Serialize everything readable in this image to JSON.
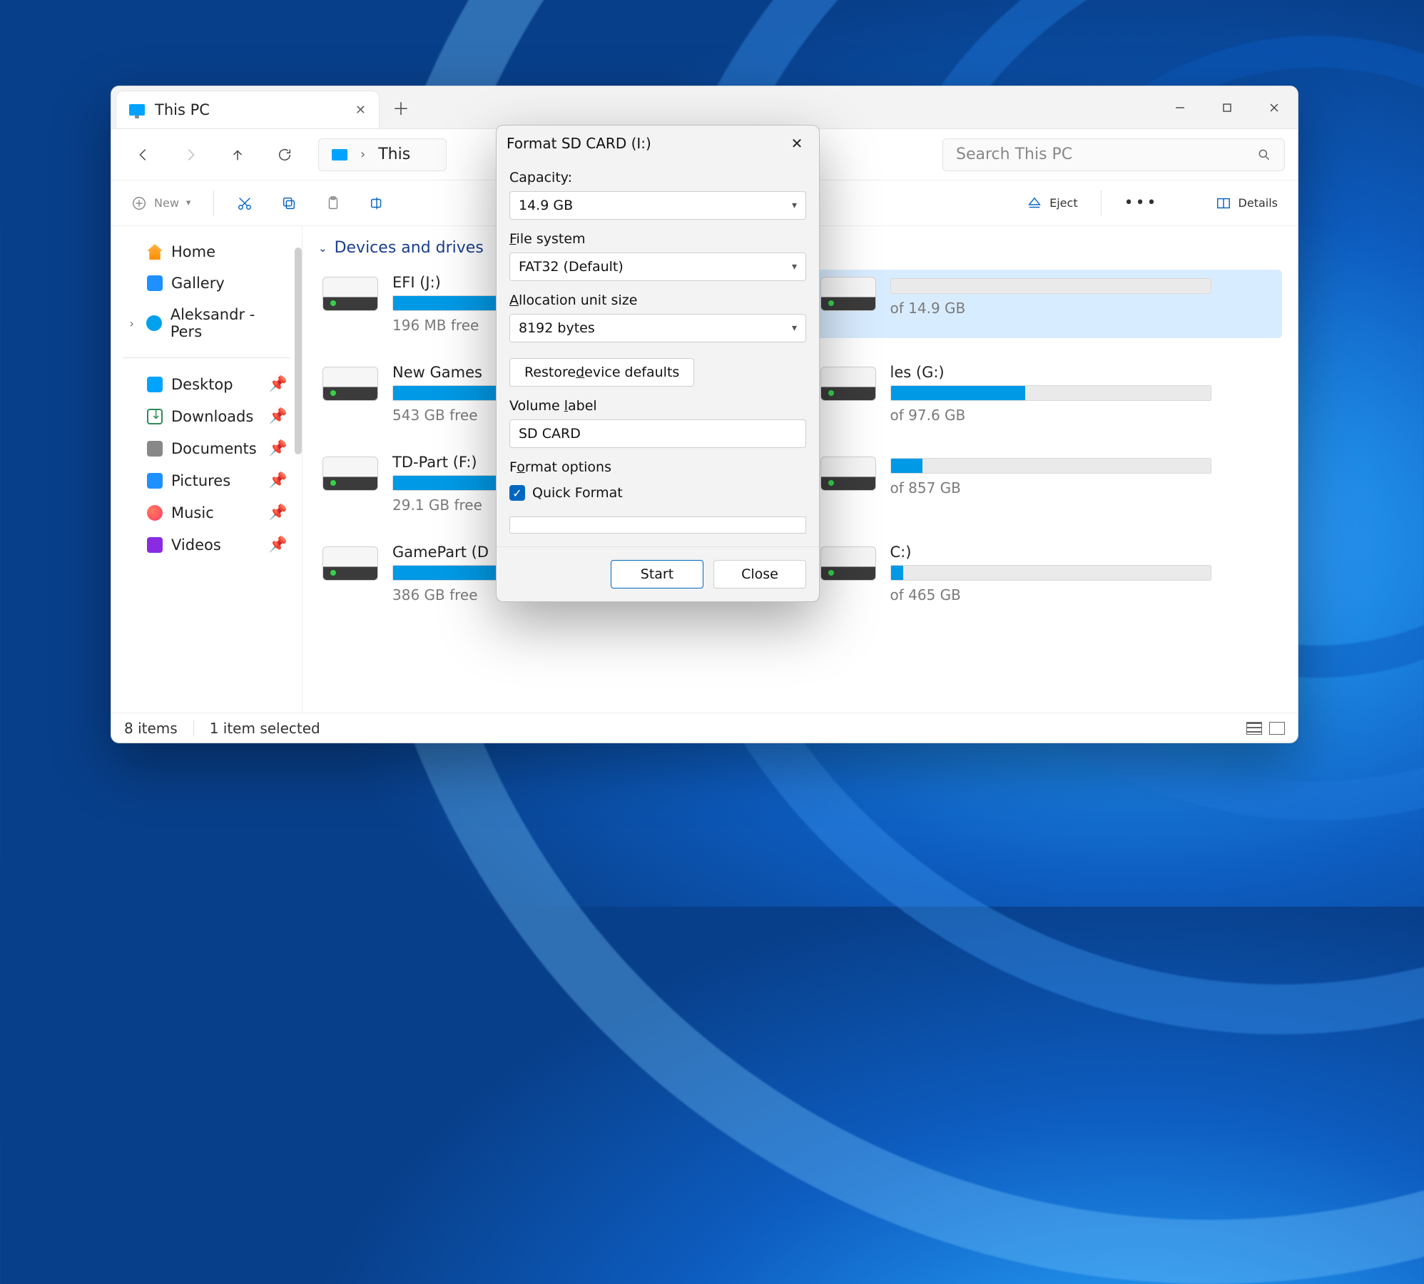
{
  "explorer": {
    "tab_title": "This PC",
    "address": "This",
    "search_placeholder": "Search This PC",
    "toolbar": {
      "new": "New",
      "eject": "Eject",
      "details": "Details"
    },
    "sidebar": {
      "home": "Home",
      "gallery": "Gallery",
      "onedrive": "Aleksandr - Pers",
      "desktop": "Desktop",
      "downloads": "Downloads",
      "documents": "Documents",
      "pictures": "Pictures",
      "music": "Music",
      "videos": "Videos"
    },
    "section_header": "Devices and drives",
    "drives": [
      {
        "name": "EFI (J:)",
        "free": "196 MB free",
        "fill": 35,
        "selected": false
      },
      {
        "name": "",
        "free": "of 14.9 GB",
        "fill": 0,
        "selected": true
      },
      {
        "name": "New Games",
        "free": "543 GB free",
        "fill": 68,
        "selected": false
      },
      {
        "name": "les (G:)",
        "free": "of 97.6 GB",
        "fill": 42,
        "selected": false
      },
      {
        "name": "TD-Part (F:)",
        "free": "29.1 GB free",
        "fill": 92,
        "selected": false
      },
      {
        "name": "",
        "free": "of 857 GB",
        "fill": 10,
        "selected": false
      },
      {
        "name": "GamePart (D",
        "free": "386 GB free",
        "fill": 60,
        "selected": false
      },
      {
        "name": "C:)",
        "free": "of 465 GB",
        "fill": 4,
        "selected": false
      }
    ],
    "status": {
      "items": "8 items",
      "selected": "1 item selected"
    }
  },
  "dialog": {
    "title": "Format SD CARD (I:)",
    "capacity_label": "Capacity:",
    "capacity_value": "14.9 GB",
    "fs_label": "File system",
    "fs_value": "FAT32 (Default)",
    "aus_label": "Allocation unit size",
    "aus_value": "8192 bytes",
    "restore": "Restore device defaults",
    "volume_label_label": "Volume label",
    "volume_label_value": "SD CARD",
    "format_options": "Format options",
    "quick_format": "Quick Format",
    "start": "Start",
    "close": "Close"
  }
}
